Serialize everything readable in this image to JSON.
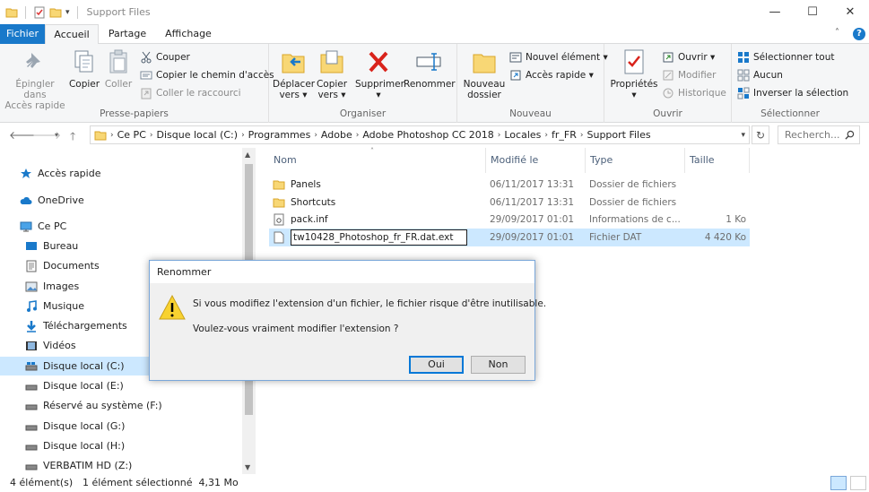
{
  "window": {
    "title": "Support Files",
    "minimize_label": "—",
    "maximize_label": "☐",
    "close_label": "✕"
  },
  "ribbon_tabs": {
    "file": "Fichier",
    "home": "Accueil",
    "share": "Partage",
    "view": "Affichage"
  },
  "ribbon": {
    "pin_label_1": "Épingler dans",
    "pin_label_2": "Accès rapide",
    "copy": "Copier",
    "paste": "Coller",
    "cut": "Couper",
    "copy_path": "Copier le chemin d'accès",
    "paste_shortcut": "Coller le raccourci",
    "group_clipboard": "Presse-papiers",
    "move_to_1": "Déplacer",
    "move_to_2": "vers ▾",
    "copy_to_1": "Copier",
    "copy_to_2": "vers ▾",
    "delete_1": "Supprimer",
    "delete_2": "▾",
    "rename": "Renommer",
    "group_organize": "Organiser",
    "new_folder_1": "Nouveau",
    "new_folder_2": "dossier",
    "new_item": "Nouvel élément ▾",
    "easy_access": "Accès rapide ▾",
    "group_new": "Nouveau",
    "properties_1": "Propriétés",
    "properties_2": "▾",
    "open": "Ouvrir ▾",
    "edit": "Modifier",
    "history": "Historique",
    "group_open": "Ouvrir",
    "select_all": "Sélectionner tout",
    "select_none": "Aucun",
    "invert_selection": "Inverser la sélection",
    "group_select": "Sélectionner"
  },
  "address": {
    "crumbs": [
      "Ce PC",
      "Disque local (C:)",
      "Programmes",
      "Adobe",
      "Adobe Photoshop CC 2018",
      "Locales",
      "fr_FR",
      "Support Files"
    ],
    "search_placeholder": "Recherch..."
  },
  "nav": {
    "items": [
      {
        "label": "Accès rapide",
        "icon": "star-icon"
      },
      {
        "label": "OneDrive",
        "icon": "cloud-icon"
      },
      {
        "label": "Ce PC",
        "icon": "computer-icon"
      },
      {
        "label": "Bureau",
        "icon": "desktop-icon"
      },
      {
        "label": "Documents",
        "icon": "documents-icon"
      },
      {
        "label": "Images",
        "icon": "pictures-icon"
      },
      {
        "label": "Musique",
        "icon": "music-icon"
      },
      {
        "label": "Téléchargements",
        "icon": "download-icon"
      },
      {
        "label": "Vidéos",
        "icon": "video-icon"
      },
      {
        "label": "Disque local (C:)",
        "icon": "drive-icon"
      },
      {
        "label": "Disque local (E:)",
        "icon": "drive-icon"
      },
      {
        "label": "Réservé au système (F:)",
        "icon": "drive-icon"
      },
      {
        "label": "Disque local (G:)",
        "icon": "drive-icon"
      },
      {
        "label": "Disque local (H:)",
        "icon": "drive-icon"
      },
      {
        "label": "VERBATIM HD (Z:)",
        "icon": "drive-icon"
      }
    ],
    "selected_index": 9
  },
  "files": {
    "columns": {
      "name": "Nom",
      "date": "Modifié le",
      "type": "Type",
      "size": "Taille"
    },
    "rows": [
      {
        "name": "Panels",
        "date": "06/11/2017 13:31",
        "type": "Dossier de fichiers",
        "size": "",
        "icon": "folder-icon"
      },
      {
        "name": "Shortcuts",
        "date": "06/11/2017 13:31",
        "type": "Dossier de fichiers",
        "size": "",
        "icon": "folder-icon"
      },
      {
        "name": "pack.inf",
        "date": "29/09/2017 01:01",
        "type": "Informations de c...",
        "size": "1 Ko",
        "icon": "file-icon"
      },
      {
        "name": "tw10428_Photoshop_fr_FR.dat.ext",
        "date": "29/09/2017 01:01",
        "type": "Fichier DAT",
        "size": "4 420 Ko",
        "icon": "file-icon"
      }
    ]
  },
  "status": {
    "count": "4 élément(s)",
    "selected": "1 élément sélectionné  4,31 Mo"
  },
  "dialog": {
    "title": "Renommer",
    "message_1": "Si vous modifiez l'extension d'un fichier, le fichier risque d'être inutilisable.",
    "message_2": "Voulez-vous vraiment modifier l'extension ?",
    "yes": "Oui",
    "no": "Non"
  },
  "colors": {
    "accent": "#1979ca",
    "selection": "#cce8ff",
    "folder": "#f8d775"
  }
}
